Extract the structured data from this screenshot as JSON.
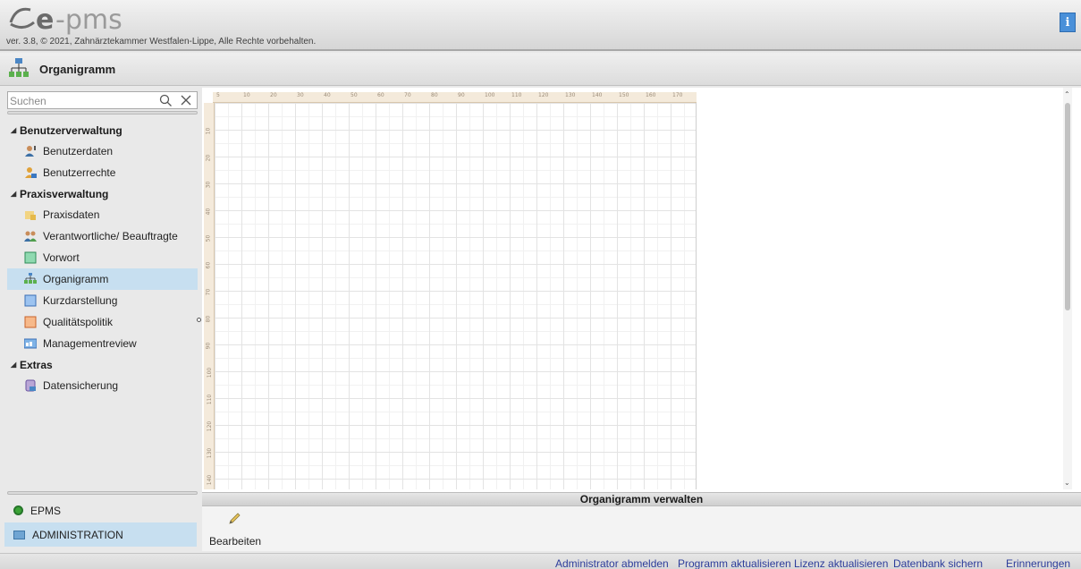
{
  "app": {
    "logo_text": "e-pms",
    "version": "ver. 3.8, © 2021, Zahnärztekammer Westfalen-Lippe, Alle Rechte vorbehalten.",
    "info_button": "i"
  },
  "page": {
    "title": "Organigramm",
    "icon": "org-chart-icon"
  },
  "search": {
    "placeholder": "Suchen",
    "value": ""
  },
  "tree": {
    "groups": [
      {
        "label": "Benutzerverwaltung",
        "items": [
          {
            "label": "Benutzerdaten",
            "icon": "user-data-icon"
          },
          {
            "label": "Benutzerrechte",
            "icon": "user-rights-icon"
          }
        ]
      },
      {
        "label": "Praxisverwaltung",
        "items": [
          {
            "label": "Praxisdaten",
            "icon": "practice-data-icon"
          },
          {
            "label": "Verantwortliche/ Beauftragte",
            "icon": "responsible-persons-icon"
          },
          {
            "label": "Vorwort",
            "icon": "foreword-icon"
          },
          {
            "label": "Organigramm",
            "icon": "org-chart-icon",
            "selected": true
          },
          {
            "label": "Kurzdarstellung",
            "icon": "summary-icon"
          },
          {
            "label": "Qualitätspolitik",
            "icon": "quality-policy-icon"
          },
          {
            "label": "Managementreview",
            "icon": "management-review-icon"
          }
        ]
      },
      {
        "label": "Extras",
        "items": [
          {
            "label": "Datensicherung",
            "icon": "backup-icon"
          }
        ]
      }
    ]
  },
  "nav": {
    "epms": "EPMS",
    "administration": "ADMINISTRATION"
  },
  "ruler": {
    "top_ticks": [
      "5",
      "10",
      "20",
      "30",
      "40",
      "50",
      "60",
      "70",
      "80",
      "90",
      "100",
      "110",
      "120",
      "130",
      "140",
      "150",
      "160",
      "170"
    ],
    "left_ticks": [
      "10",
      "20",
      "30",
      "40",
      "50",
      "60",
      "70",
      "80",
      "90",
      "100",
      "110",
      "120",
      "130",
      "140"
    ]
  },
  "panel": {
    "title": "Organigramm verwalten",
    "edit_label": "Bearbeiten"
  },
  "footer": {
    "links": [
      "Administrator abmelden",
      "Programm aktualisieren",
      "Lizenz aktualisieren",
      "Datenbank sichern",
      "Erinnerungen"
    ]
  },
  "colors": {
    "selection": "#c7dff0",
    "link": "#2d3d9b",
    "status_online": "#3ba336"
  }
}
